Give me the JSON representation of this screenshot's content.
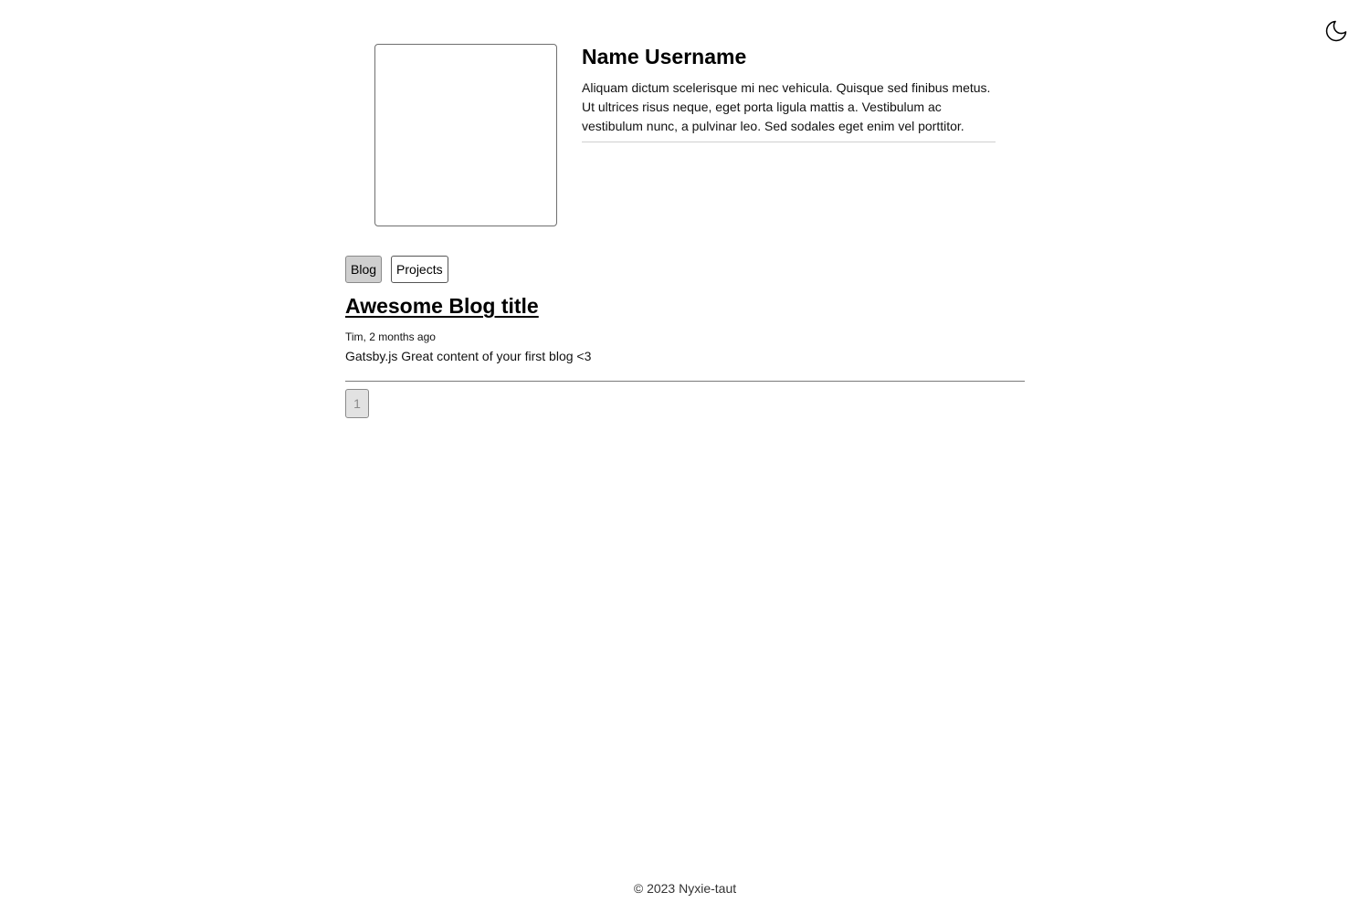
{
  "theme_toggle": {
    "icon": "moon-icon"
  },
  "profile": {
    "name": "Name Username",
    "bio": "Aliquam dictum scelerisque mi nec vehicula. Quisque sed finibus metus. Ut ultrices risus neque, eget porta ligula mattis a. Vestibulum ac vestibulum nunc, a pulvinar leo. Sed sodales eget enim vel porttitor."
  },
  "tabs": [
    {
      "label": "Blog",
      "active": true
    },
    {
      "label": "Projects",
      "active": false
    }
  ],
  "posts": [
    {
      "title": "Awesome Blog title",
      "meta": "Tim, 2 months ago",
      "excerpt": "Gatsby.js Great content of your first blog <3"
    }
  ],
  "pagination": {
    "current_page": "1"
  },
  "footer": {
    "text": "© 2023 Nyxie-taut"
  }
}
